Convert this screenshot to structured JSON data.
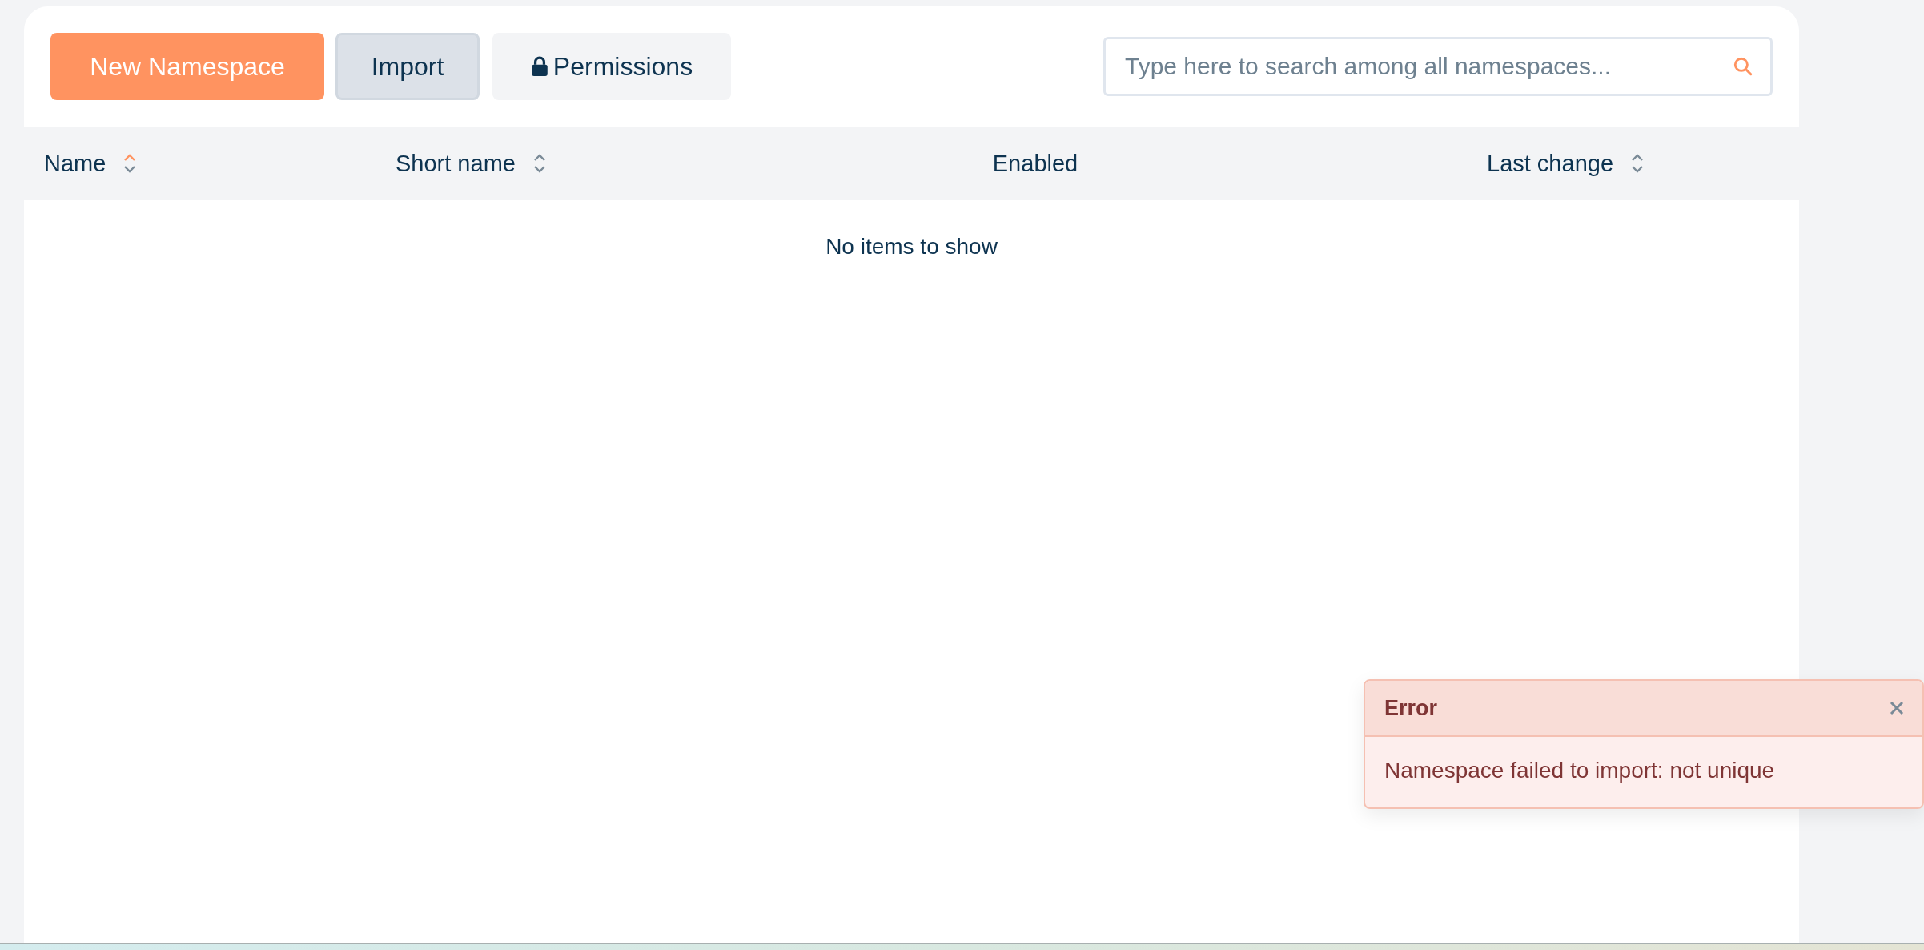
{
  "toolbar": {
    "buttons": [
      {
        "label": "New Namespace",
        "kind": "primary"
      },
      {
        "label": "Import",
        "kind": "secondary"
      },
      {
        "label": "Permissions",
        "kind": "lock"
      }
    ],
    "search": {
      "placeholder": "Type here to search among all namespaces..."
    }
  },
  "table": {
    "columns": [
      {
        "label": "Name",
        "sortable": true,
        "sorted": true
      },
      {
        "label": "Short name",
        "sortable": true,
        "sorted": false
      },
      {
        "label": "Enabled",
        "sortable": false
      },
      {
        "label": "Last change",
        "sortable": true,
        "sorted": false
      }
    ],
    "empty_message": "No items to show"
  },
  "toast": {
    "title": "Error",
    "message": "Namespace failed to import: not unique"
  }
}
